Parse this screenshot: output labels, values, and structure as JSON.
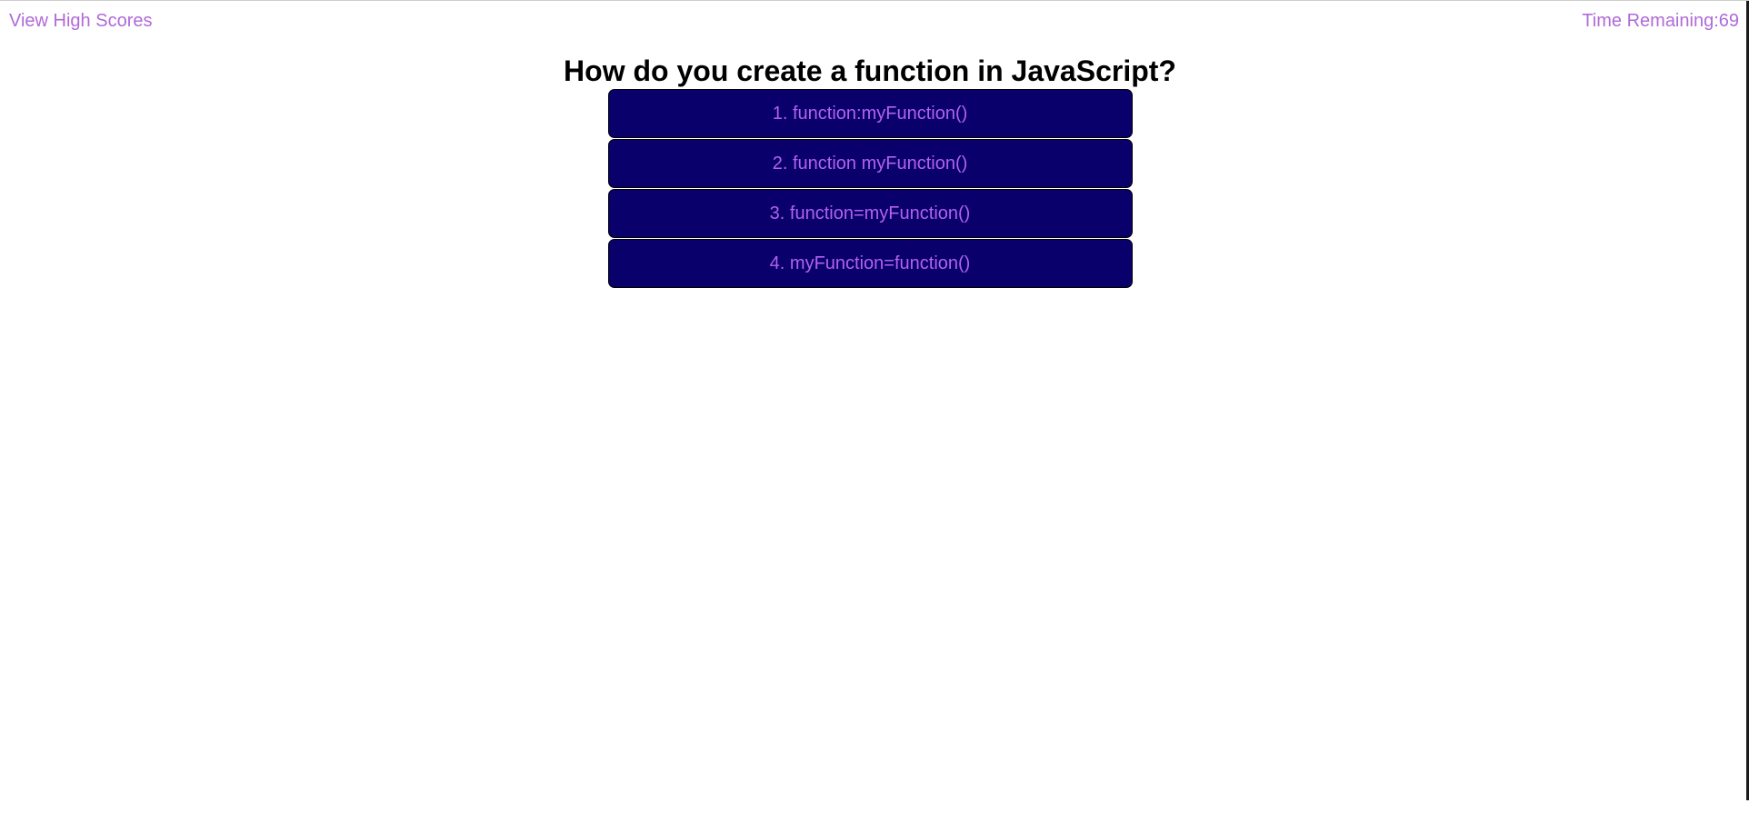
{
  "header": {
    "high_scores_label": "View High Scores",
    "timer_label": "Time Remaining:",
    "timer_value": "69"
  },
  "quiz": {
    "question": "How do you create a function in JavaScript?",
    "answers": [
      {
        "label": "1. function:myFunction()"
      },
      {
        "label": "2. function myFunction()"
      },
      {
        "label": "3. function=myFunction()"
      },
      {
        "label": "4. myFunction=function()"
      }
    ]
  },
  "colors": {
    "link_text": "#b06ad8",
    "button_bg": "#0a006b",
    "button_text": "#b062f0"
  }
}
